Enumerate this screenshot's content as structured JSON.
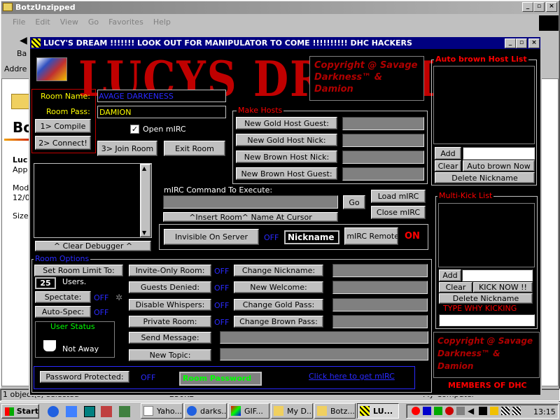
{
  "explorer": {
    "title": "BotzUnzipped",
    "menu": [
      "File",
      "Edit",
      "View",
      "Go",
      "Favorites",
      "Help"
    ],
    "back": "Ba",
    "address": "Addre",
    "side_title": "Bo",
    "side_name": "Luc",
    "side_app": "App",
    "side_mod": "Mod",
    "side_date": "12/0",
    "side_size": "Size",
    "status": "1 object(s) selected",
    "status_size": "230KB",
    "status_loc": "My Computer"
  },
  "app": {
    "title": "LUCY'S DREAM !!!!!!! LOOK OUT FOR MANIPULATOR TO COME !!!!!!!!!! DHC HACKERS",
    "logo": "LUCYS DREAM",
    "copyright_top": "Copyright @ Savage Darkness™ & Damion",
    "copyright_bottom": "Copyright @ Savage Darkness™ & Damion",
    "members": "MEMBERS OF DHC"
  },
  "room": {
    "name_label": "Room Name:",
    "name_value": "SAVAGE DARKENESS",
    "pass_label": "Room Pass:",
    "pass_value": "DAMION",
    "compile": "1> Compile",
    "connect": "2> Connect!",
    "open_mirc": "Open mIRC",
    "join_room": "3> Join Room",
    "exit_room": "Exit Room"
  },
  "make_hosts": {
    "title": "Make Hosts",
    "btn1": "New Gold Host Guest:",
    "btn2": "New Gold Host Nick:",
    "btn3": "New Brown Host Nick:",
    "btn4": "New Brown Host Guest:"
  },
  "auto_brown": {
    "title": "Auto brown Host List",
    "add": "Add",
    "clear": "Clear",
    "auto": "Auto brown Now",
    "delete": "Delete Nickname"
  },
  "multikick": {
    "title": "Multi-Kick List",
    "add": "Add",
    "clear": "Clear",
    "kick": "KICK NOW !!",
    "delete": "Delete Nickname",
    "reason": "TYPE WHY KICKING"
  },
  "debugger": {
    "clear": "^ Clear Debugger ^"
  },
  "mirc": {
    "cmd_label": "mIRC Command To Execute:",
    "go": "Go",
    "insert": "^Insert Room^ Name At Cursor",
    "load": "Load mIRC",
    "close": "Close mIRC",
    "invisible": "Invisible On Server",
    "invisible_state": "OFF",
    "nickname": "Nickname",
    "remote": "mIRC Remote:",
    "remote_state": "ON"
  },
  "room_options": {
    "title": "Room Options",
    "limit_btn": "Set Room Limit To:",
    "limit_value": "25",
    "users": "Users.",
    "spectate": "Spectate:",
    "spectate_state": "OFF",
    "autospec": "Auto-Spec:",
    "autospec_state": "OFF",
    "user_status_title": "User Status",
    "user_status": "Not Away",
    "invite_only": "Invite-Only Room:",
    "invite_state": "OFF",
    "guests_denied": "Guests Denied:",
    "guests_state": "OFF",
    "disable_whispers": "Disable Whispers:",
    "whispers_state": "OFF",
    "private_room": "Private Room:",
    "private_state": "OFF",
    "send_message": "Send Message:",
    "new_topic": "New Topic:",
    "change_nick": "Change Nickname:",
    "new_welcome": "New Welcome:",
    "change_gold": "Change Gold Pass:",
    "change_brown": "Change Brown Pass:",
    "pw_protected": "Password Protected:",
    "pw_state": "OFF",
    "room_password": "Room Password",
    "get_mirc": "Click here to get mIRC"
  },
  "taskbar": {
    "start": "Start",
    "items": [
      "Yaho...",
      "darks...",
      "GIF...",
      "My D...",
      "Botz...",
      "LU..."
    ],
    "clock": "13:15"
  }
}
